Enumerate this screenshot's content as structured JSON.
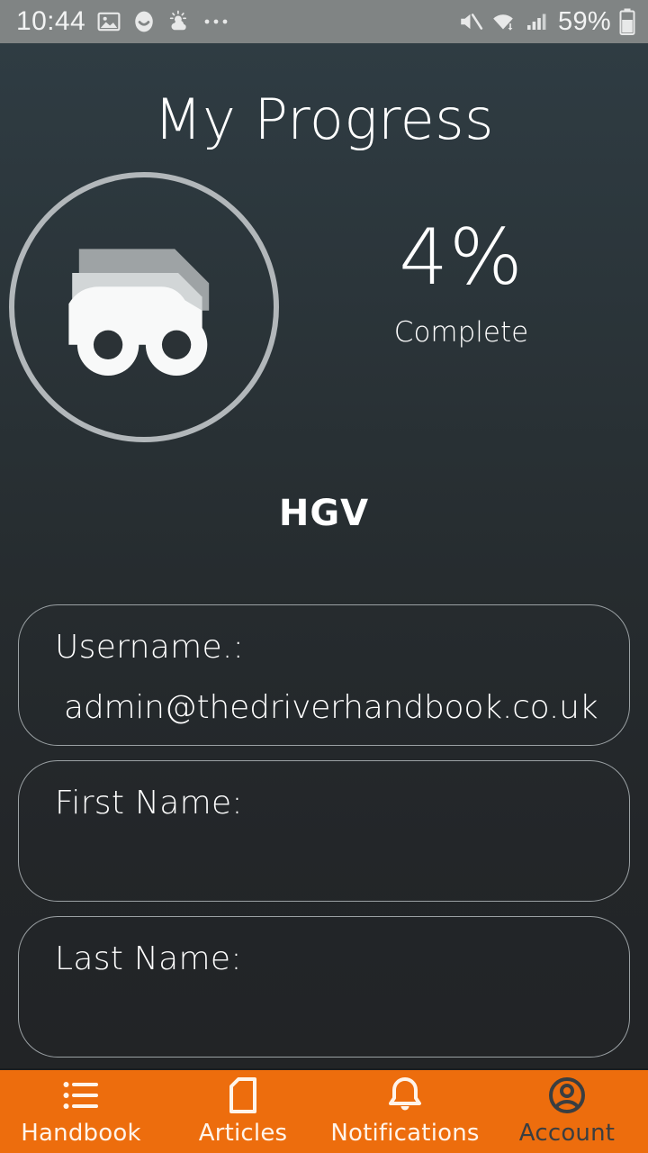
{
  "statusbar": {
    "time": "10:44",
    "left_icons": [
      "image-icon",
      "smiley-icon",
      "weather-icon",
      "overflow-dots-icon"
    ],
    "battery_percent": "59%",
    "right_icons": [
      "mute-icon",
      "wifi-icon",
      "signal-icon",
      "battery-icon"
    ]
  },
  "header": {
    "title": "My Progress"
  },
  "progress": {
    "badge_icon": "truck-icon",
    "percent": "4%",
    "percent_label": "Complete",
    "category": "HGV",
    "circle_color": "#b2b7ba"
  },
  "form": {
    "fields": [
      {
        "label": "Username.:",
        "value": "admin@thedriverhandbook.co.uk"
      },
      {
        "label": "First Name:",
        "value": ""
      },
      {
        "label": "Last Name:",
        "value": ""
      }
    ]
  },
  "tabbar": {
    "accent": "#ED6D0D",
    "active_index": 3,
    "tabs": [
      {
        "label": "Handbook",
        "icon": "list-icon"
      },
      {
        "label": "Articles",
        "icon": "document-icon"
      },
      {
        "label": "Notifications",
        "icon": "bell-icon"
      },
      {
        "label": "Account",
        "icon": "account-circle-icon"
      }
    ]
  }
}
